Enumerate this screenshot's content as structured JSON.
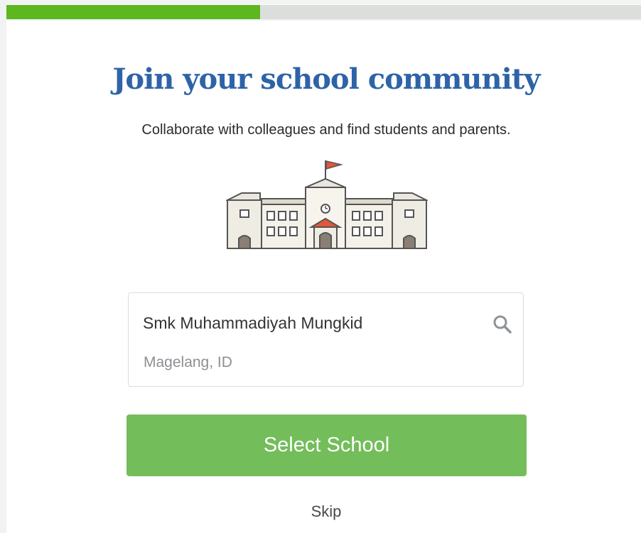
{
  "progress": {
    "fraction": 0.4,
    "fill_color": "#5db71e",
    "track_color": "#dcdedb"
  },
  "header": {
    "title": "Join your school community",
    "subtitle": "Collaborate with colleagues and find students and parents."
  },
  "illustration": {
    "icon": "school-building-icon"
  },
  "search": {
    "value": "Smk Muhammadiyah Mungkid",
    "icon": "search-icon",
    "location": "Magelang, ID"
  },
  "actions": {
    "select_label": "Select School",
    "skip_label": "Skip"
  },
  "colors": {
    "title": "#2e63a7",
    "button": "#73bd5a"
  }
}
